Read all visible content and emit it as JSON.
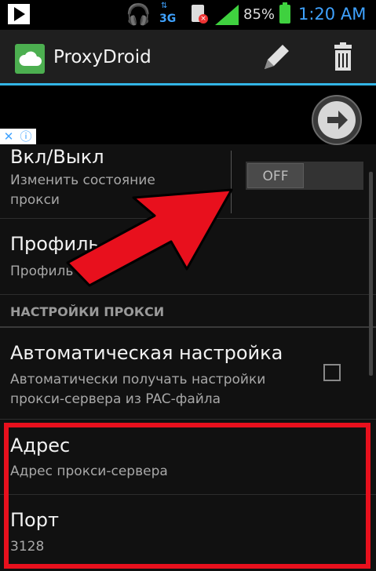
{
  "status_bar": {
    "network": "3G",
    "battery": "85%",
    "time": "1:20 AM"
  },
  "action_bar": {
    "title": "ProxyDroid",
    "icons": [
      "cloud-logo-icon",
      "pencil-icon",
      "trash-icon"
    ]
  },
  "ad": {
    "icons": [
      "close-x-icon",
      "info-icon"
    ]
  },
  "prefs": {
    "toggle": {
      "title": "Вкл/Выкл",
      "summary_line1": "Изменить состояние",
      "summary_line2": "прокси",
      "state": "OFF"
    },
    "profile": {
      "title": "Профиль",
      "summary": "Профиль 1"
    },
    "section_header": "НАСТРОЙКИ ПРОКСИ",
    "auto": {
      "title": "Автоматическая настройка",
      "summary_line1": "Автоматически получать настройки",
      "summary_line2": "прокси-сервера из PAC-файла",
      "checked": false
    },
    "address": {
      "title": "Адрес",
      "summary": "Адрес прокси-сервера"
    },
    "port": {
      "title": "Порт",
      "value": "3128"
    }
  },
  "colors": {
    "accent": "#33b5e5",
    "highlight": "#e8101d",
    "logo": "#4caf50"
  }
}
